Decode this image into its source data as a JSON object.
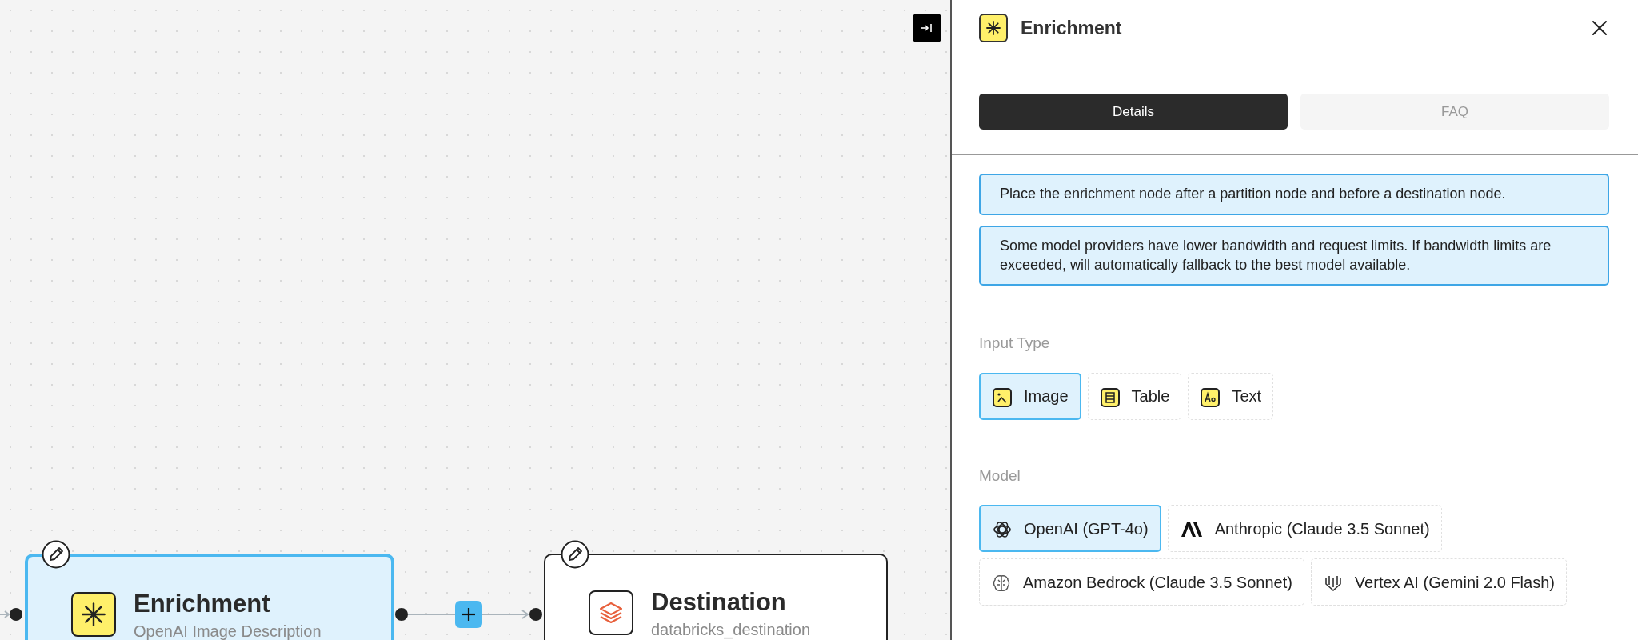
{
  "canvas": {
    "nodes": [
      {
        "kind": "enrichment",
        "title": "Enrichment",
        "subtitle": "OpenAI Image Description",
        "selected": true
      },
      {
        "kind": "destination",
        "title": "Destination",
        "subtitle": "databricks_destination",
        "selected": false
      }
    ]
  },
  "panel": {
    "title": "Enrichment",
    "tabs": [
      {
        "label": "Details",
        "selected": true
      },
      {
        "label": "FAQ",
        "selected": false
      }
    ],
    "notes": [
      "Place the enrichment node after a partition node and before a destination node.",
      "Some model providers have lower bandwidth and request limits. If bandwidth limits are exceeded, will automatically fallback to the best model available."
    ],
    "input_type": {
      "label": "Input Type",
      "options": [
        {
          "kind": "image",
          "label": "Image",
          "selected": true
        },
        {
          "kind": "table",
          "label": "Table",
          "selected": false
        },
        {
          "kind": "text",
          "label": "Text",
          "selected": false
        }
      ]
    },
    "model": {
      "label": "Model",
      "options": [
        {
          "kind": "openai",
          "label": "OpenAI (GPT-4o)",
          "selected": true
        },
        {
          "kind": "anthropic",
          "label": "Anthropic (Claude 3.5 Sonnet)",
          "selected": false
        },
        {
          "kind": "bedrock",
          "label": "Amazon Bedrock (Claude 3.5 Sonnet)",
          "selected": false
        },
        {
          "kind": "vertex",
          "label": "Vertex AI (Gemini 2.0 Flash)",
          "selected": false
        }
      ]
    }
  }
}
